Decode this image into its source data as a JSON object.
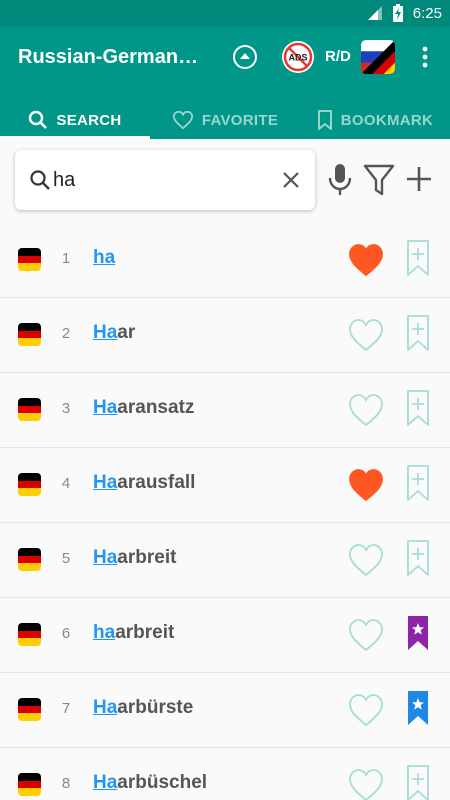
{
  "status_bar": {
    "time": "6:25"
  },
  "app_bar": {
    "title": "Russian-German Dictionary",
    "ads_badge": "ADS",
    "direction_label": "R/D"
  },
  "tabs": [
    {
      "label": "SEARCH",
      "icon": "search-icon",
      "active": true
    },
    {
      "label": "FAVORITE",
      "icon": "heart-outline-icon",
      "active": false
    },
    {
      "label": "BOOKMARK",
      "icon": "bookmark-outline-icon",
      "active": false
    }
  ],
  "search": {
    "value": "ha",
    "placeholder": ""
  },
  "colors": {
    "primary": "#009688",
    "primary_dark": "#00897b",
    "highlight": "#2196f3",
    "favorite_filled": "#ff5722",
    "outline_icon": "#a5dcd6",
    "bookmark_purple": "#8e24aa",
    "bookmark_blue": "#1e88e5"
  },
  "results": [
    {
      "index": "1",
      "match": "ha",
      "rest": "",
      "favorite": true,
      "bookmark": "none"
    },
    {
      "index": "2",
      "match": "Ha",
      "rest": "ar",
      "favorite": false,
      "bookmark": "none"
    },
    {
      "index": "3",
      "match": "Ha",
      "rest": "aransatz",
      "favorite": false,
      "bookmark": "none"
    },
    {
      "index": "4",
      "match": "Ha",
      "rest": "arausfall",
      "favorite": true,
      "bookmark": "none"
    },
    {
      "index": "5",
      "match": "Ha",
      "rest": "arbreit",
      "favorite": false,
      "bookmark": "none"
    },
    {
      "index": "6",
      "match": "ha",
      "rest": "arbreit",
      "favorite": false,
      "bookmark": "purple"
    },
    {
      "index": "7",
      "match": "Ha",
      "rest": "arbürste",
      "favorite": false,
      "bookmark": "blue"
    },
    {
      "index": "8",
      "match": "Ha",
      "rest": "arbüschel",
      "favorite": false,
      "bookmark": "none"
    }
  ]
}
